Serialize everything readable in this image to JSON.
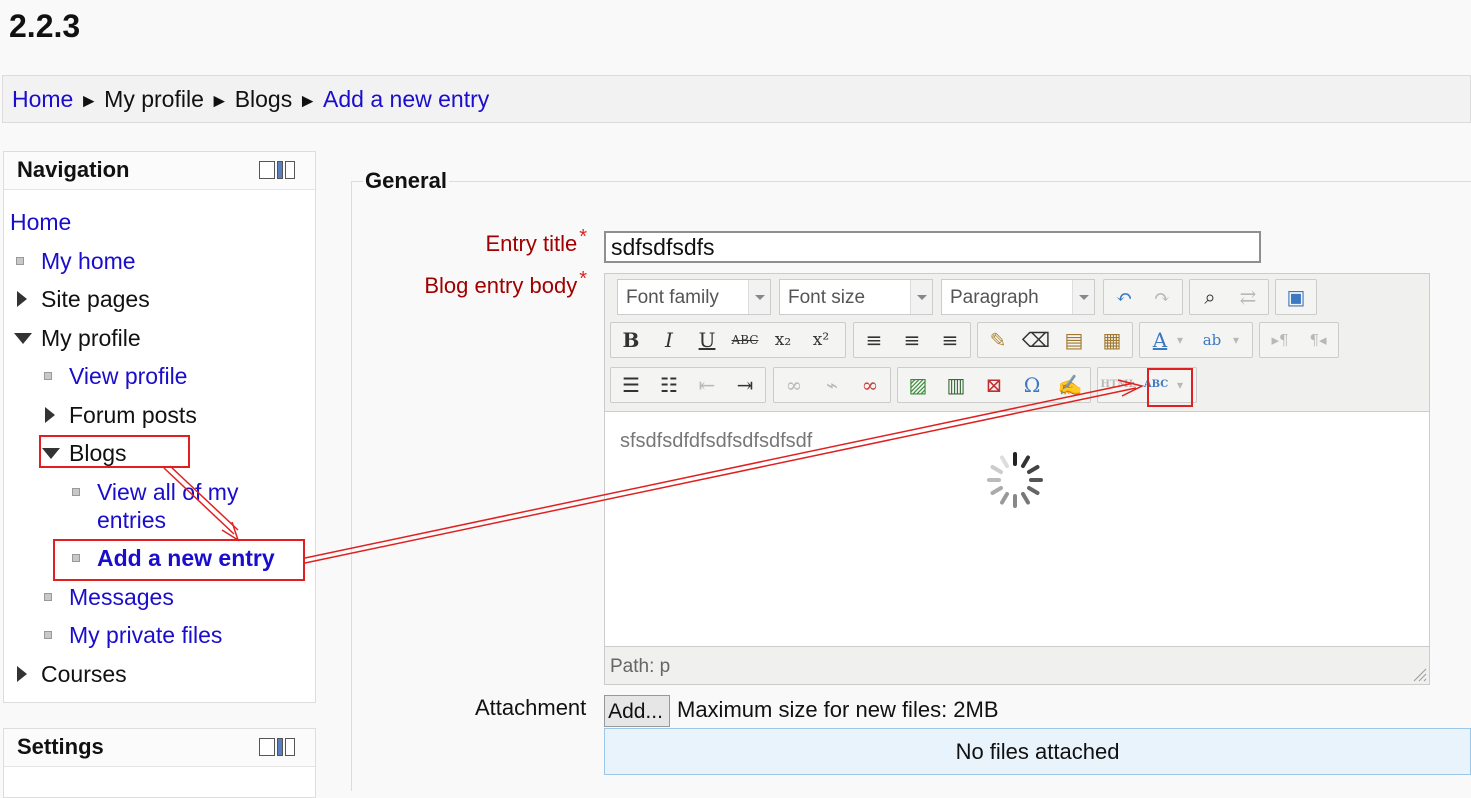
{
  "site_title": "2.2.3",
  "breadcrumb": {
    "home": "Home",
    "sep": "►",
    "my_profile": "My profile",
    "blogs": "Blogs",
    "current": "Add a new entry"
  },
  "navigation": {
    "title": "Navigation",
    "items": {
      "home": "Home",
      "my_home": "My home",
      "site_pages": "Site pages",
      "my_profile": "My profile",
      "view_profile": "View profile",
      "forum_posts": "Forum posts",
      "blogs": "Blogs",
      "view_all_line1": "View all of my",
      "view_all_line2": "entries",
      "add_new_entry": "Add a new entry",
      "messages": "Messages",
      "private_files": "My private files",
      "courses": "Courses"
    }
  },
  "settings": {
    "title": "Settings"
  },
  "form": {
    "legend": "General",
    "entry_title_label": "Entry title",
    "entry_title_value": "sdfsdfsdfs",
    "body_label": "Blog entry body",
    "required_mark": "*",
    "toolbar": {
      "font_family": "Font family",
      "font_size": "Font size",
      "format": "Paragraph",
      "bold": "B",
      "italic": "I",
      "underline": "U",
      "strike": "ABC",
      "subscript": "x₂",
      "superscript": "x²",
      "html": "HTML",
      "omega": "Ω",
      "spellcheck": "ABC"
    },
    "body_text": "sfsdfsdfdfsdfsdfsdfsdf",
    "path": "Path: p",
    "attachment_label": "Attachment",
    "add_button": "Add...",
    "max_size": "Maximum size for new files: 2MB",
    "no_files": "No files attached"
  },
  "colors": {
    "link": "#1a0dcc",
    "label_red": "#a00000",
    "annotation": "#e02020"
  }
}
